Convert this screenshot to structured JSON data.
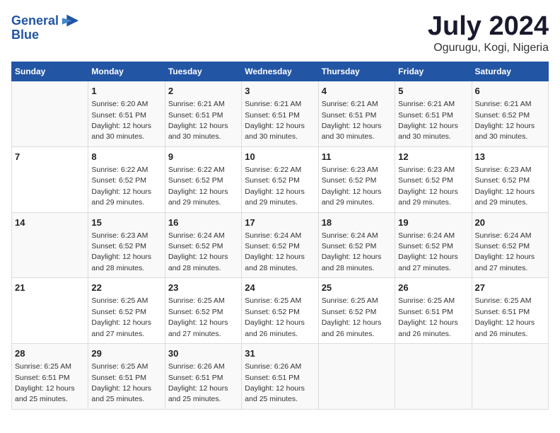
{
  "header": {
    "logo_line1": "General",
    "logo_line2": "Blue",
    "title": "July 2024",
    "subtitle": "Ogurugu, Kogi, Nigeria"
  },
  "calendar": {
    "days_of_week": [
      "Sunday",
      "Monday",
      "Tuesday",
      "Wednesday",
      "Thursday",
      "Friday",
      "Saturday"
    ],
    "weeks": [
      [
        {
          "day": "",
          "content": ""
        },
        {
          "day": "1",
          "content": "Sunrise: 6:20 AM\nSunset: 6:51 PM\nDaylight: 12 hours\nand 30 minutes."
        },
        {
          "day": "2",
          "content": "Sunrise: 6:21 AM\nSunset: 6:51 PM\nDaylight: 12 hours\nand 30 minutes."
        },
        {
          "day": "3",
          "content": "Sunrise: 6:21 AM\nSunset: 6:51 PM\nDaylight: 12 hours\nand 30 minutes."
        },
        {
          "day": "4",
          "content": "Sunrise: 6:21 AM\nSunset: 6:51 PM\nDaylight: 12 hours\nand 30 minutes."
        },
        {
          "day": "5",
          "content": "Sunrise: 6:21 AM\nSunset: 6:51 PM\nDaylight: 12 hours\nand 30 minutes."
        },
        {
          "day": "6",
          "content": "Sunrise: 6:21 AM\nSunset: 6:52 PM\nDaylight: 12 hours\nand 30 minutes."
        }
      ],
      [
        {
          "day": "7",
          "content": ""
        },
        {
          "day": "8",
          "content": "Sunrise: 6:22 AM\nSunset: 6:52 PM\nDaylight: 12 hours\nand 29 minutes."
        },
        {
          "day": "9",
          "content": "Sunrise: 6:22 AM\nSunset: 6:52 PM\nDaylight: 12 hours\nand 29 minutes."
        },
        {
          "day": "10",
          "content": "Sunrise: 6:22 AM\nSunset: 6:52 PM\nDaylight: 12 hours\nand 29 minutes."
        },
        {
          "day": "11",
          "content": "Sunrise: 6:23 AM\nSunset: 6:52 PM\nDaylight: 12 hours\nand 29 minutes."
        },
        {
          "day": "12",
          "content": "Sunrise: 6:23 AM\nSunset: 6:52 PM\nDaylight: 12 hours\nand 29 minutes."
        },
        {
          "day": "13",
          "content": "Sunrise: 6:23 AM\nSunset: 6:52 PM\nDaylight: 12 hours\nand 29 minutes."
        }
      ],
      [
        {
          "day": "14",
          "content": ""
        },
        {
          "day": "15",
          "content": "Sunrise: 6:23 AM\nSunset: 6:52 PM\nDaylight: 12 hours\nand 28 minutes."
        },
        {
          "day": "16",
          "content": "Sunrise: 6:24 AM\nSunset: 6:52 PM\nDaylight: 12 hours\nand 28 minutes."
        },
        {
          "day": "17",
          "content": "Sunrise: 6:24 AM\nSunset: 6:52 PM\nDaylight: 12 hours\nand 28 minutes."
        },
        {
          "day": "18",
          "content": "Sunrise: 6:24 AM\nSunset: 6:52 PM\nDaylight: 12 hours\nand 28 minutes."
        },
        {
          "day": "19",
          "content": "Sunrise: 6:24 AM\nSunset: 6:52 PM\nDaylight: 12 hours\nand 27 minutes."
        },
        {
          "day": "20",
          "content": "Sunrise: 6:24 AM\nSunset: 6:52 PM\nDaylight: 12 hours\nand 27 minutes."
        }
      ],
      [
        {
          "day": "21",
          "content": ""
        },
        {
          "day": "22",
          "content": "Sunrise: 6:25 AM\nSunset: 6:52 PM\nDaylight: 12 hours\nand 27 minutes."
        },
        {
          "day": "23",
          "content": "Sunrise: 6:25 AM\nSunset: 6:52 PM\nDaylight: 12 hours\nand 27 minutes."
        },
        {
          "day": "24",
          "content": "Sunrise: 6:25 AM\nSunset: 6:52 PM\nDaylight: 12 hours\nand 26 minutes."
        },
        {
          "day": "25",
          "content": "Sunrise: 6:25 AM\nSunset: 6:52 PM\nDaylight: 12 hours\nand 26 minutes."
        },
        {
          "day": "26",
          "content": "Sunrise: 6:25 AM\nSunset: 6:51 PM\nDaylight: 12 hours\nand 26 minutes."
        },
        {
          "day": "27",
          "content": "Sunrise: 6:25 AM\nSunset: 6:51 PM\nDaylight: 12 hours\nand 26 minutes."
        }
      ],
      [
        {
          "day": "28",
          "content": "Sunrise: 6:25 AM\nSunset: 6:51 PM\nDaylight: 12 hours\nand 25 minutes."
        },
        {
          "day": "29",
          "content": "Sunrise: 6:25 AM\nSunset: 6:51 PM\nDaylight: 12 hours\nand 25 minutes."
        },
        {
          "day": "30",
          "content": "Sunrise: 6:26 AM\nSunset: 6:51 PM\nDaylight: 12 hours\nand 25 minutes."
        },
        {
          "day": "31",
          "content": "Sunrise: 6:26 AM\nSunset: 6:51 PM\nDaylight: 12 hours\nand 25 minutes."
        },
        {
          "day": "",
          "content": ""
        },
        {
          "day": "",
          "content": ""
        },
        {
          "day": "",
          "content": ""
        }
      ]
    ]
  }
}
